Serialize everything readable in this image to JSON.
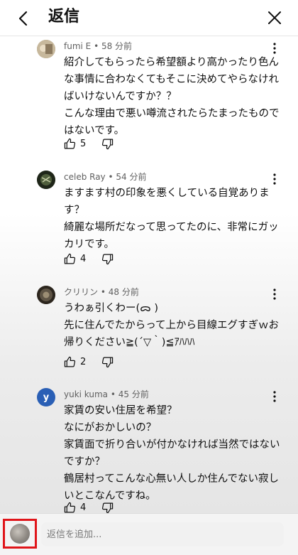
{
  "header": {
    "title": "返信"
  },
  "reply_bar": {
    "placeholder": "返信を追加..."
  },
  "comments": [
    {
      "author": "fumi E",
      "time": "58 分前",
      "lines": [
        "紹介してもらったら希望額より高かったり色ん",
        "な事情に合わなくてもそこに決めてやらなけれ",
        "ばいけないんですか？？",
        "こんな理由で悪い噂流されたらたまったもので",
        "はないです。"
      ],
      "likes": "5",
      "avatar_color": "#b9a98f"
    },
    {
      "author": "celeb Ray",
      "time": "54 分前",
      "lines": [
        "ますます村の印象を悪くしている自覚ありま",
        "す？",
        "綺麗な場所だなって思ってたのに、非常にガッ",
        "カリです。"
      ],
      "likes": "4",
      "avatar_color": "#2f3a2a"
    },
    {
      "author": "クリリン",
      "time": "48 分前",
      "lines": [
        "うわぁ引くわー(ᯅ )",
        "先に住んでたからって上から目線エグすぎｗお",
        "帰りください≧(´▽｀)≦ｱﾊﾊﾊ"
      ],
      "likes": "2",
      "avatar_color": "#3d352a"
    },
    {
      "author": "yuki kuma",
      "time": "45 分前",
      "avatar_letter": "y",
      "lines": [
        "家賃の安い住居を希望？",
        "なにがおかしいの？",
        "家賃面で折り合いが付かなければ当然ではない",
        "ですか？",
        "鶴居村ってこんな心無い人しか住んでない寂し",
        "いとこなんですね。"
      ],
      "likes": "4",
      "avatar_color": "#2a5fb5"
    }
  ]
}
